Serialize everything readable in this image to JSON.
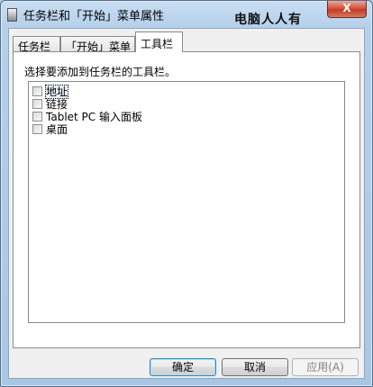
{
  "window": {
    "title": "任务栏和「开始」菜单属性",
    "watermark": "电脑人人有",
    "close_glyph": "X"
  },
  "tabs": [
    {
      "label": "任务栏",
      "active": false
    },
    {
      "label": "「开始」菜单",
      "active": false
    },
    {
      "label": "工具栏",
      "active": true
    }
  ],
  "toolbar_page": {
    "instruction": "选择要添加到任务栏的工具栏。",
    "items": [
      {
        "label": "地址",
        "checked": false,
        "focused": true
      },
      {
        "label": "链接",
        "checked": false,
        "focused": false
      },
      {
        "label": "Tablet PC 输入面板",
        "checked": false,
        "focused": false
      },
      {
        "label": "桌面",
        "checked": false,
        "focused": false
      }
    ]
  },
  "buttons": {
    "ok": "确定",
    "cancel": "取消",
    "apply": "应用(A)"
  }
}
